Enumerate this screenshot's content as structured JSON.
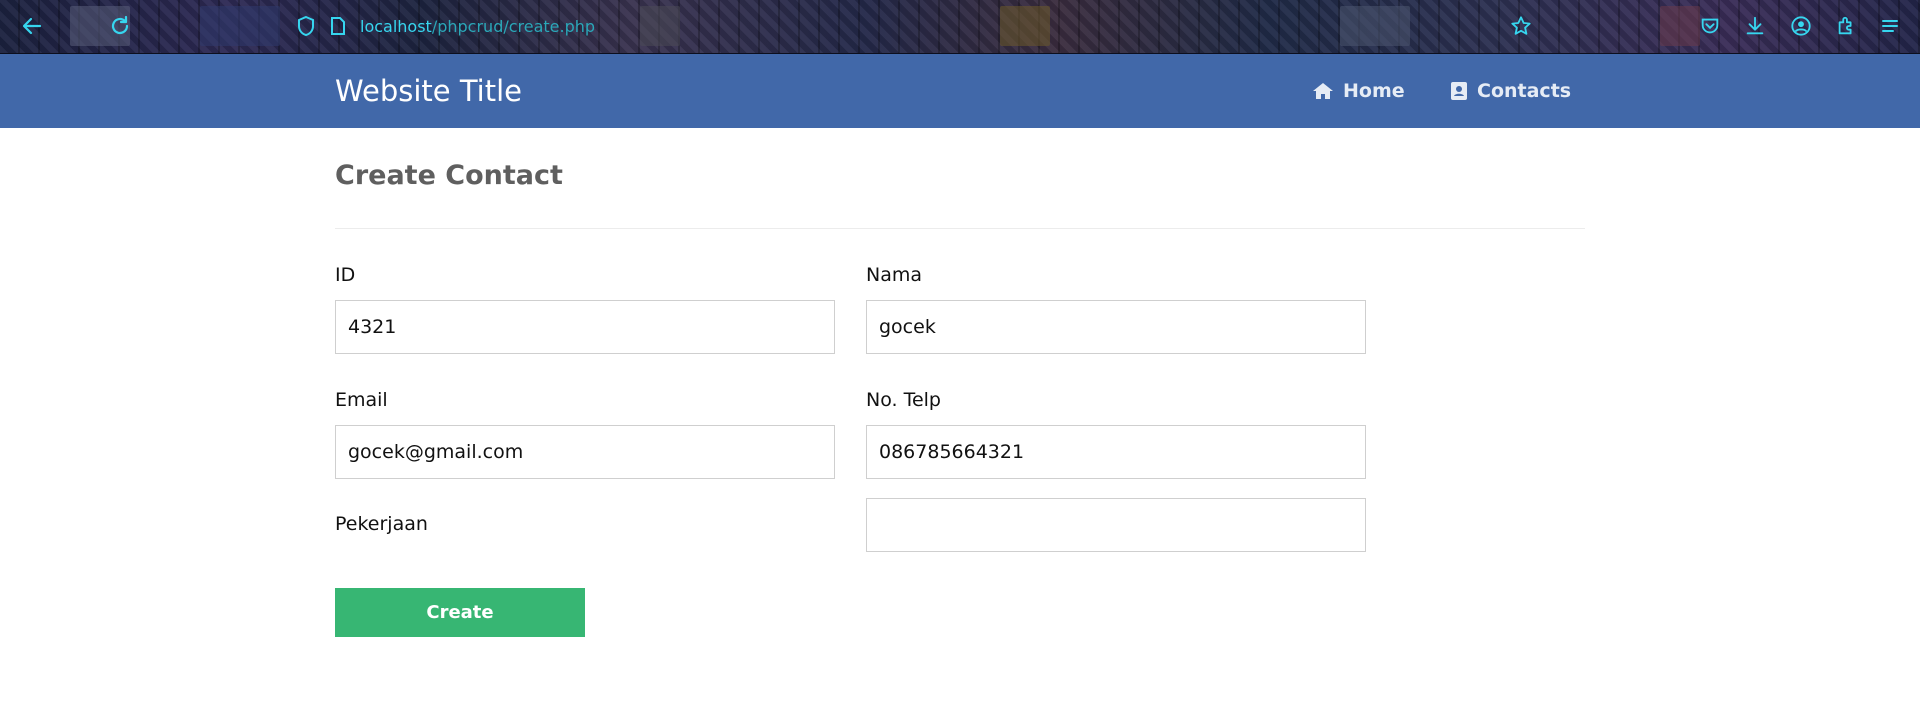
{
  "browser": {
    "url_host": "localhost",
    "url_path": "/phpcrud/create.php",
    "icons": [
      "back-icon",
      "reload-icon",
      "shield-icon",
      "page-icon",
      "star-icon",
      "pocket-icon",
      "download-icon",
      "account-icon",
      "extensions-icon",
      "menu-icon"
    ],
    "accent_color": "#36d6ef"
  },
  "navbar": {
    "title": "Website Title",
    "links": [
      {
        "label": "Home",
        "icon": "home-icon"
      },
      {
        "label": "Contacts",
        "icon": "address-book-icon"
      }
    ],
    "background_color": "#4168a9"
  },
  "page": {
    "heading": "Create Contact"
  },
  "form": {
    "id": {
      "label": "ID",
      "value": "4321"
    },
    "nama": {
      "label": "Nama",
      "value": "gocek"
    },
    "email": {
      "label": "Email",
      "value": "gocek@gmail.com"
    },
    "telp": {
      "label": "No. Telp",
      "value": "086785664321"
    },
    "pekerjaan": {
      "label": "Pekerjaan",
      "value": ""
    },
    "submit_label": "Create",
    "submit_color": "#37b673"
  }
}
